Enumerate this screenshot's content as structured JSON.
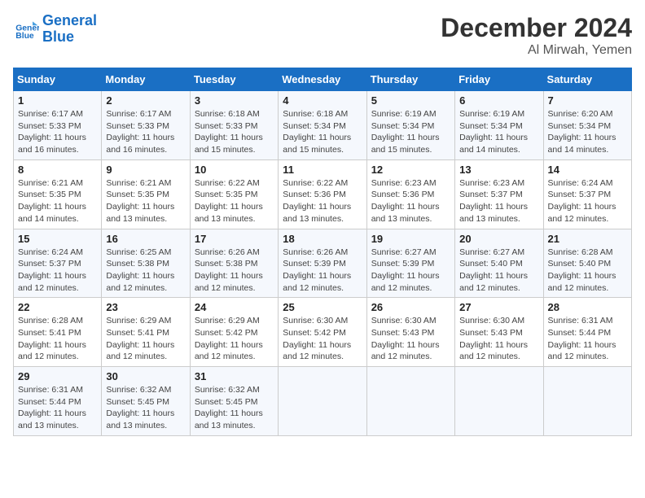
{
  "header": {
    "logo_line1": "General",
    "logo_line2": "Blue",
    "month": "December 2024",
    "location": "Al Mirwah, Yemen"
  },
  "columns": [
    "Sunday",
    "Monday",
    "Tuesday",
    "Wednesday",
    "Thursday",
    "Friday",
    "Saturday"
  ],
  "weeks": [
    [
      {
        "day": "1",
        "sunrise": "6:17 AM",
        "sunset": "5:33 PM",
        "daylight": "11 hours and 16 minutes."
      },
      {
        "day": "2",
        "sunrise": "6:17 AM",
        "sunset": "5:33 PM",
        "daylight": "11 hours and 16 minutes."
      },
      {
        "day": "3",
        "sunrise": "6:18 AM",
        "sunset": "5:33 PM",
        "daylight": "11 hours and 15 minutes."
      },
      {
        "day": "4",
        "sunrise": "6:18 AM",
        "sunset": "5:34 PM",
        "daylight": "11 hours and 15 minutes."
      },
      {
        "day": "5",
        "sunrise": "6:19 AM",
        "sunset": "5:34 PM",
        "daylight": "11 hours and 15 minutes."
      },
      {
        "day": "6",
        "sunrise": "6:19 AM",
        "sunset": "5:34 PM",
        "daylight": "11 hours and 14 minutes."
      },
      {
        "day": "7",
        "sunrise": "6:20 AM",
        "sunset": "5:34 PM",
        "daylight": "11 hours and 14 minutes."
      }
    ],
    [
      {
        "day": "8",
        "sunrise": "6:21 AM",
        "sunset": "5:35 PM",
        "daylight": "11 hours and 14 minutes."
      },
      {
        "day": "9",
        "sunrise": "6:21 AM",
        "sunset": "5:35 PM",
        "daylight": "11 hours and 13 minutes."
      },
      {
        "day": "10",
        "sunrise": "6:22 AM",
        "sunset": "5:35 PM",
        "daylight": "11 hours and 13 minutes."
      },
      {
        "day": "11",
        "sunrise": "6:22 AM",
        "sunset": "5:36 PM",
        "daylight": "11 hours and 13 minutes."
      },
      {
        "day": "12",
        "sunrise": "6:23 AM",
        "sunset": "5:36 PM",
        "daylight": "11 hours and 13 minutes."
      },
      {
        "day": "13",
        "sunrise": "6:23 AM",
        "sunset": "5:37 PM",
        "daylight": "11 hours and 13 minutes."
      },
      {
        "day": "14",
        "sunrise": "6:24 AM",
        "sunset": "5:37 PM",
        "daylight": "11 hours and 12 minutes."
      }
    ],
    [
      {
        "day": "15",
        "sunrise": "6:24 AM",
        "sunset": "5:37 PM",
        "daylight": "11 hours and 12 minutes."
      },
      {
        "day": "16",
        "sunrise": "6:25 AM",
        "sunset": "5:38 PM",
        "daylight": "11 hours and 12 minutes."
      },
      {
        "day": "17",
        "sunrise": "6:26 AM",
        "sunset": "5:38 PM",
        "daylight": "11 hours and 12 minutes."
      },
      {
        "day": "18",
        "sunrise": "6:26 AM",
        "sunset": "5:39 PM",
        "daylight": "11 hours and 12 minutes."
      },
      {
        "day": "19",
        "sunrise": "6:27 AM",
        "sunset": "5:39 PM",
        "daylight": "11 hours and 12 minutes."
      },
      {
        "day": "20",
        "sunrise": "6:27 AM",
        "sunset": "5:40 PM",
        "daylight": "11 hours and 12 minutes."
      },
      {
        "day": "21",
        "sunrise": "6:28 AM",
        "sunset": "5:40 PM",
        "daylight": "11 hours and 12 minutes."
      }
    ],
    [
      {
        "day": "22",
        "sunrise": "6:28 AM",
        "sunset": "5:41 PM",
        "daylight": "11 hours and 12 minutes."
      },
      {
        "day": "23",
        "sunrise": "6:29 AM",
        "sunset": "5:41 PM",
        "daylight": "11 hours and 12 minutes."
      },
      {
        "day": "24",
        "sunrise": "6:29 AM",
        "sunset": "5:42 PM",
        "daylight": "11 hours and 12 minutes."
      },
      {
        "day": "25",
        "sunrise": "6:30 AM",
        "sunset": "5:42 PM",
        "daylight": "11 hours and 12 minutes."
      },
      {
        "day": "26",
        "sunrise": "6:30 AM",
        "sunset": "5:43 PM",
        "daylight": "11 hours and 12 minutes."
      },
      {
        "day": "27",
        "sunrise": "6:30 AM",
        "sunset": "5:43 PM",
        "daylight": "11 hours and 12 minutes."
      },
      {
        "day": "28",
        "sunrise": "6:31 AM",
        "sunset": "5:44 PM",
        "daylight": "11 hours and 12 minutes."
      }
    ],
    [
      {
        "day": "29",
        "sunrise": "6:31 AM",
        "sunset": "5:44 PM",
        "daylight": "11 hours and 13 minutes."
      },
      {
        "day": "30",
        "sunrise": "6:32 AM",
        "sunset": "5:45 PM",
        "daylight": "11 hours and 13 minutes."
      },
      {
        "day": "31",
        "sunrise": "6:32 AM",
        "sunset": "5:45 PM",
        "daylight": "11 hours and 13 minutes."
      },
      null,
      null,
      null,
      null
    ]
  ]
}
